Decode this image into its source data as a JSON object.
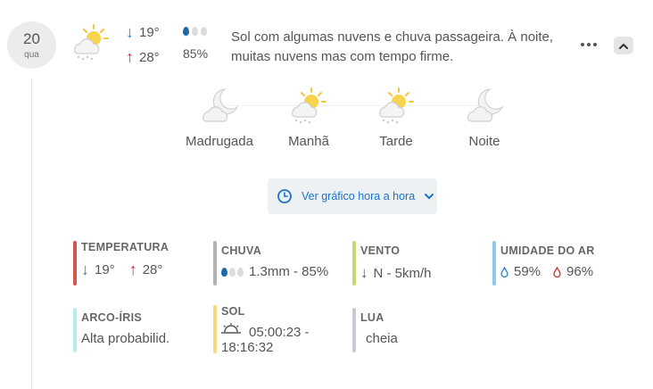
{
  "day": {
    "number": "20",
    "weekday": "qua",
    "icon": "sun-cloud-rain-icon",
    "temp_min": "19°",
    "temp_max": "28°",
    "precip_percent": "85%",
    "description": "Sol com algumas nuvens e chuva passageira. À noite, muitas nuvens mas com tempo firme."
  },
  "periods": [
    {
      "label": "Madrugada",
      "icon": "moon-cloud-icon"
    },
    {
      "label": "Manhã",
      "icon": "sun-cloud-rain-icon"
    },
    {
      "label": "Tarde",
      "icon": "sun-cloud-rain-icon"
    },
    {
      "label": "Noite",
      "icon": "moon-cloud-icon"
    }
  ],
  "hourly_button": {
    "label": "Ver gráfico hora a hora"
  },
  "details": {
    "temperatura": {
      "title": "TEMPERATURA",
      "min": "19°",
      "max": "28°",
      "color": "#d9534f"
    },
    "chuva": {
      "title": "CHUVA",
      "value": "1.3mm - 85%",
      "color": "#b3b3b3"
    },
    "vento": {
      "title": "VENTO",
      "value": "N - 5km/h",
      "color": "#c5d870"
    },
    "umidade": {
      "title": "UMIDADE DO AR",
      "min": "59%",
      "max": "96%",
      "color": "#8ec9f0"
    },
    "arco_iris": {
      "title": "ARCO-ÍRIS",
      "value": "Alta probabilid.",
      "color": "#b8ecec"
    },
    "sol": {
      "title": "SOL",
      "line1": "05:00:23 -",
      "line2": "18:16:32",
      "color": "#f5dc7d"
    },
    "lua": {
      "title": "LUA",
      "value": "cheia",
      "color": "#c8ccd2"
    }
  },
  "colors": {
    "accent_blue": "#1a73c9",
    "down_arrow": "#2f7fc1",
    "up_arrow": "#c9302c",
    "sun": "#f7c531"
  }
}
